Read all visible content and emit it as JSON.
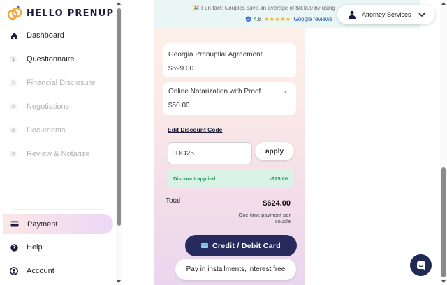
{
  "app": {
    "name": "HELLO PRENUP"
  },
  "sidebar": {
    "items": [
      {
        "label": "Dashboard",
        "icon": "home-icon"
      },
      {
        "label": "Questionnaire",
        "step": "1"
      },
      {
        "label": "Financial Disclosure",
        "step": "2"
      },
      {
        "label": "Negotiations",
        "step": "3"
      },
      {
        "label": "Documents",
        "step": "4"
      },
      {
        "label": "Review & Notarize",
        "step": "5"
      }
    ],
    "bottom": [
      {
        "label": "Payment",
        "icon": "card-icon",
        "active": true
      },
      {
        "label": "Help",
        "icon": "help-icon"
      },
      {
        "label": "Account",
        "icon": "account-icon"
      }
    ]
  },
  "banner": {
    "fun_fact": "🎉  Fun fact: Couples save an average of $8,000 by using",
    "rating": "4.8",
    "stars": "★★★★★",
    "rating_source": "Google reviews"
  },
  "header": {
    "attorney_services": "Attorney Services"
  },
  "order": {
    "items": [
      {
        "name": "Georgia Prenuptial Agreement",
        "price": "$599.00"
      },
      {
        "name": "Online Notarization with Proof",
        "price": "$50.00",
        "remove": "×"
      }
    ],
    "edit_discount": "Edit Discount Code",
    "discount_code": "IDO25",
    "apply_label": "apply",
    "discount_applied_label": "Discount applied",
    "discount_amount": "-$25.00",
    "total_label": "Total",
    "total_value": "$624.00",
    "total_note": "One-time payment per couple",
    "pay_card_label": "Credit / Debit Card",
    "pay_installments_label": "Pay in installments, interest free"
  },
  "colors": {
    "accent_dark": "#272a5c",
    "banner_bg": "#e9f6f3",
    "discount_green": "#2e9a5e",
    "star_gold": "#f2b01e"
  }
}
